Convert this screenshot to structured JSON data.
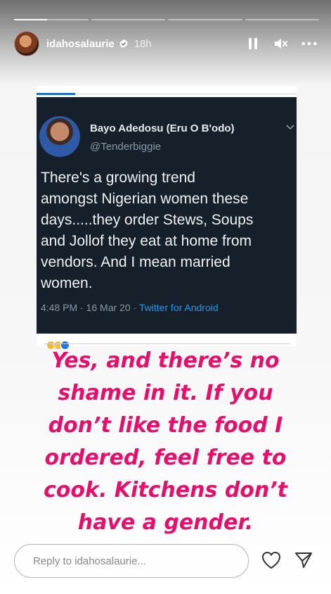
{
  "story": {
    "progress": {
      "segments": 4,
      "active_fill": 0.45
    },
    "user": {
      "username": "idahosalaurie",
      "verified": true,
      "time_ago": "18h"
    },
    "controls": {
      "pause_icon": "pause-icon",
      "mute_icon": "muted-speaker-icon",
      "more_icon": "more-horizontal-icon"
    }
  },
  "tweet": {
    "name": "Bayo Adedosu (Eru O B'odo)",
    "handle": "@Tenderbiggie",
    "body": "There's a growing trend\namongst Nigerian women these\ndays.....they order Stews, Soups\nand Jollof they eat at home from\nvendors. And I mean married\nwomen.",
    "time": "4:48 PM · 16 Mar 20 · ",
    "source": "Twitter for Android",
    "colors": {
      "background": "#15202b",
      "accent": "#1d9bf0"
    }
  },
  "caption": {
    "text": "Yes, and there’s no\nshame in it. If you\ndon’t like the food I\nordered, feel free to\ncook. Kitchens don’t\nhave a gender.",
    "color": "#e4106b"
  },
  "reply": {
    "placeholder": "Reply to idahosalaurie...",
    "like_icon": "heart-icon",
    "send_icon": "send-icon"
  }
}
